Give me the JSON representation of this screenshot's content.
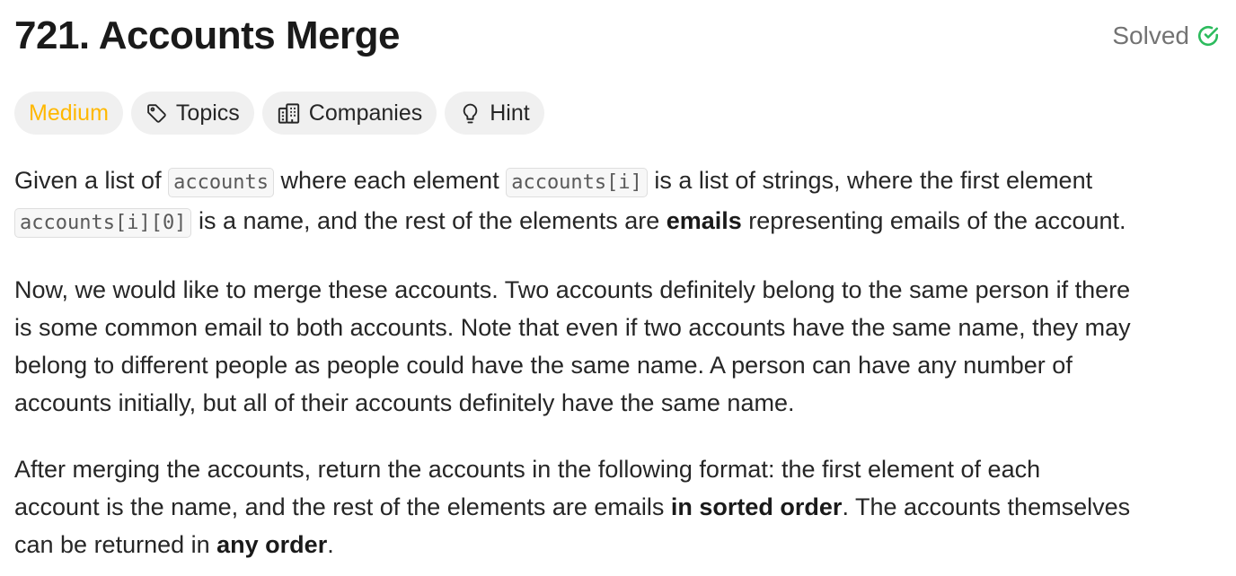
{
  "problem": {
    "title": "721. Accounts Merge",
    "status": "Solved"
  },
  "tags": {
    "difficulty": "Medium",
    "topics": "Topics",
    "companies": "Companies",
    "hint": "Hint"
  },
  "colors": {
    "difficulty_medium": "#ffb800",
    "solved_check": "#2cbb5d",
    "tag_background": "#f0f0f0"
  },
  "icons": {
    "solved": "check-circle-icon",
    "topics": "tag-icon",
    "companies": "building-icon",
    "hint": "lightbulb-icon"
  },
  "description": {
    "p1": {
      "t1": "Given a list of ",
      "c1": "accounts",
      "t2": " where each element ",
      "c2": "accounts[i]",
      "t3": " is a list of strings, where the first element",
      "c3": "accounts[i][0]",
      "t4": " is a name, and the rest of the elements are ",
      "b1": "emails",
      "t5": " representing emails of the account."
    },
    "p2": {
      "l1": "Now, we would like to merge these accounts. Two accounts definitely belong to the same person if there",
      "l2": "is some common email to both accounts. Note that even if two accounts have the same name, they may",
      "l3": "belong to different people as people could have the same name. A person can have any number of",
      "l4": "accounts initially, but all of their accounts definitely have the same name."
    },
    "p3": {
      "l1": "After merging the accounts, return the accounts in the following format: the first element of each",
      "t1": "account is the name, and the rest of the elements are emails ",
      "b1": "in sorted order",
      "t2": ". The accounts themselves",
      "t3": "can be returned in ",
      "b2": "any order",
      "t4": "."
    }
  }
}
